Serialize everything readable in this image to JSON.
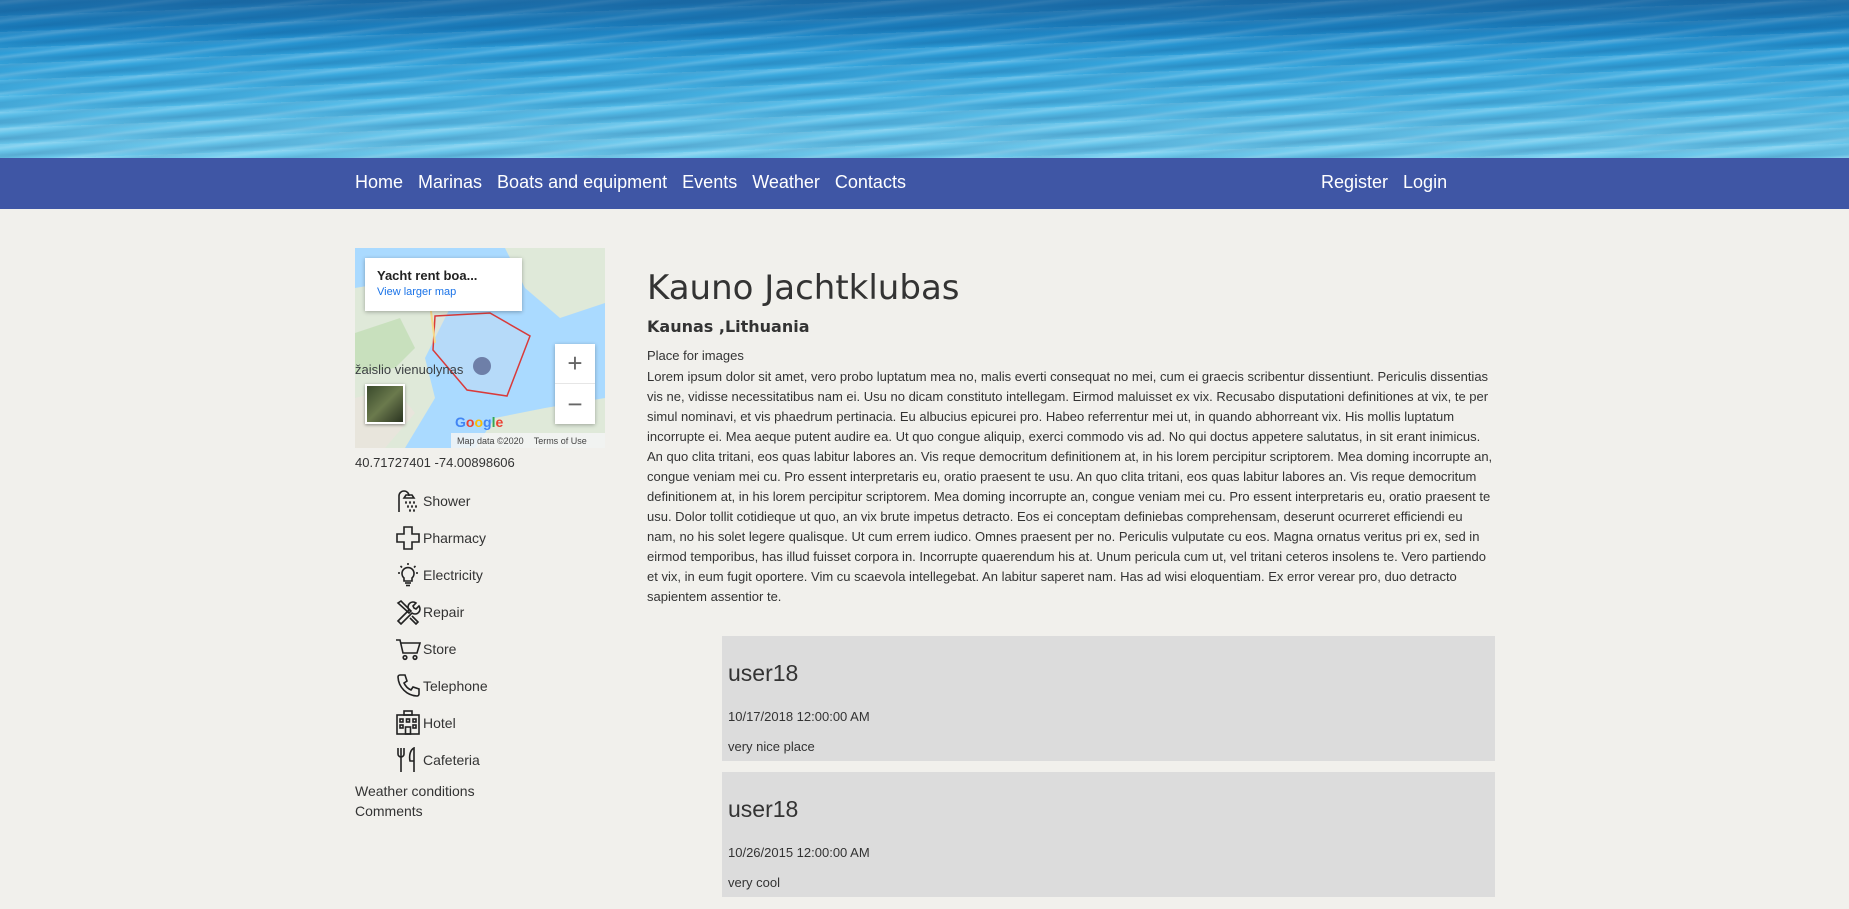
{
  "nav": {
    "left": [
      "Home",
      "Marinas",
      "Boats and equipment",
      "Events",
      "Weather",
      "Contacts"
    ],
    "right": [
      "Register",
      "Login"
    ]
  },
  "map": {
    "info_title": "Yacht rent boa...",
    "info_link": "View larger map",
    "place_label": "žaislio vienuolynas",
    "logo": "Google",
    "map_data": "Map data ©2020",
    "terms": "Terms of Use",
    "zoom_in": "+",
    "zoom_out": "−"
  },
  "coords": "40.71727401 -74.00898606",
  "amenities": [
    {
      "label": "Shower",
      "icon": "shower-icon"
    },
    {
      "label": "Pharmacy",
      "icon": "pharmacy-icon"
    },
    {
      "label": "Electricity",
      "icon": "electricity-icon"
    },
    {
      "label": "Repair",
      "icon": "repair-icon"
    },
    {
      "label": "Store",
      "icon": "store-icon"
    },
    {
      "label": "Telephone",
      "icon": "telephone-icon"
    },
    {
      "label": "Hotel",
      "icon": "hotel-icon"
    },
    {
      "label": "Cafeteria",
      "icon": "cafeteria-icon"
    }
  ],
  "side_links": {
    "weather": "Weather conditions",
    "comments": "Comments"
  },
  "marina": {
    "title": "Kauno Jachtklubas",
    "location": "Kaunas ,Lithuania",
    "images_placeholder": "Place for images",
    "description": "Lorem ipsum dolor sit amet, vero probo luptatum mea no, malis everti consequat no mei, cum ei graecis scribentur dissentiunt. Periculis dissentias vis ne, vidisse necessitatibus nam ei. Usu no dicam constituto intellegam. Eirmod maluisset ex vix. Recusabo disputationi definitiones at vix, te per simul nominavi, et vis phaedrum pertinacia. Eu albucius epicurei pro. Habeo referrentur mei ut, in quando abhorreant vix. His mollis luptatum incorrupte ei. Mea aeque putent audire ea. Ut quo congue aliquip, exerci commodo vis ad. No qui doctus appetere salutatus, in sit erant inimicus. An quo clita tritani, eos quas labitur labores an. Vis reque democritum definitionem at, in his lorem percipitur scriptorem. Mea doming incorrupte an, congue veniam mei cu. Pro essent interpretaris eu, oratio praesent te usu. An quo clita tritani, eos quas labitur labores an. Vis reque democritum definitionem at, in his lorem percipitur scriptorem. Mea doming incorrupte an, congue veniam mei cu. Pro essent interpretaris eu, oratio praesent te usu. Dolor tollit cotidieque ut quo, an vix brute impetus detracto. Eos ei conceptam definiebas comprehensam, deserunt ocurreret efficiendi eu nam, no his solet legere qualisque. Ut cum errem iudico. Omnes praesent per no. Periculis vulputate cu eos. Magna ornatus veritus pri ex, sed in eirmod temporibus, has illud fuisset corpora in. Incorrupte quaerendum his at. Unum pericula cum ut, vel tritani ceteros insolens te. Vero partiendo et vix, in eum fugit oportere. Vim cu scaevola intellegebat. An labitur saperet nam. Has ad wisi eloquentiam. Ex error verear pro, duo detracto sapientem assentior te."
  },
  "comments": [
    {
      "user": "user18",
      "date": "10/17/2018 12:00:00 AM",
      "text": "very nice place"
    },
    {
      "user": "user18",
      "date": "10/26/2015 12:00:00 AM",
      "text": "very cool"
    }
  ],
  "colors": {
    "navbar": "#3f56a5",
    "background": "#f1f0ec",
    "comment_bg": "#dcdcdc"
  }
}
